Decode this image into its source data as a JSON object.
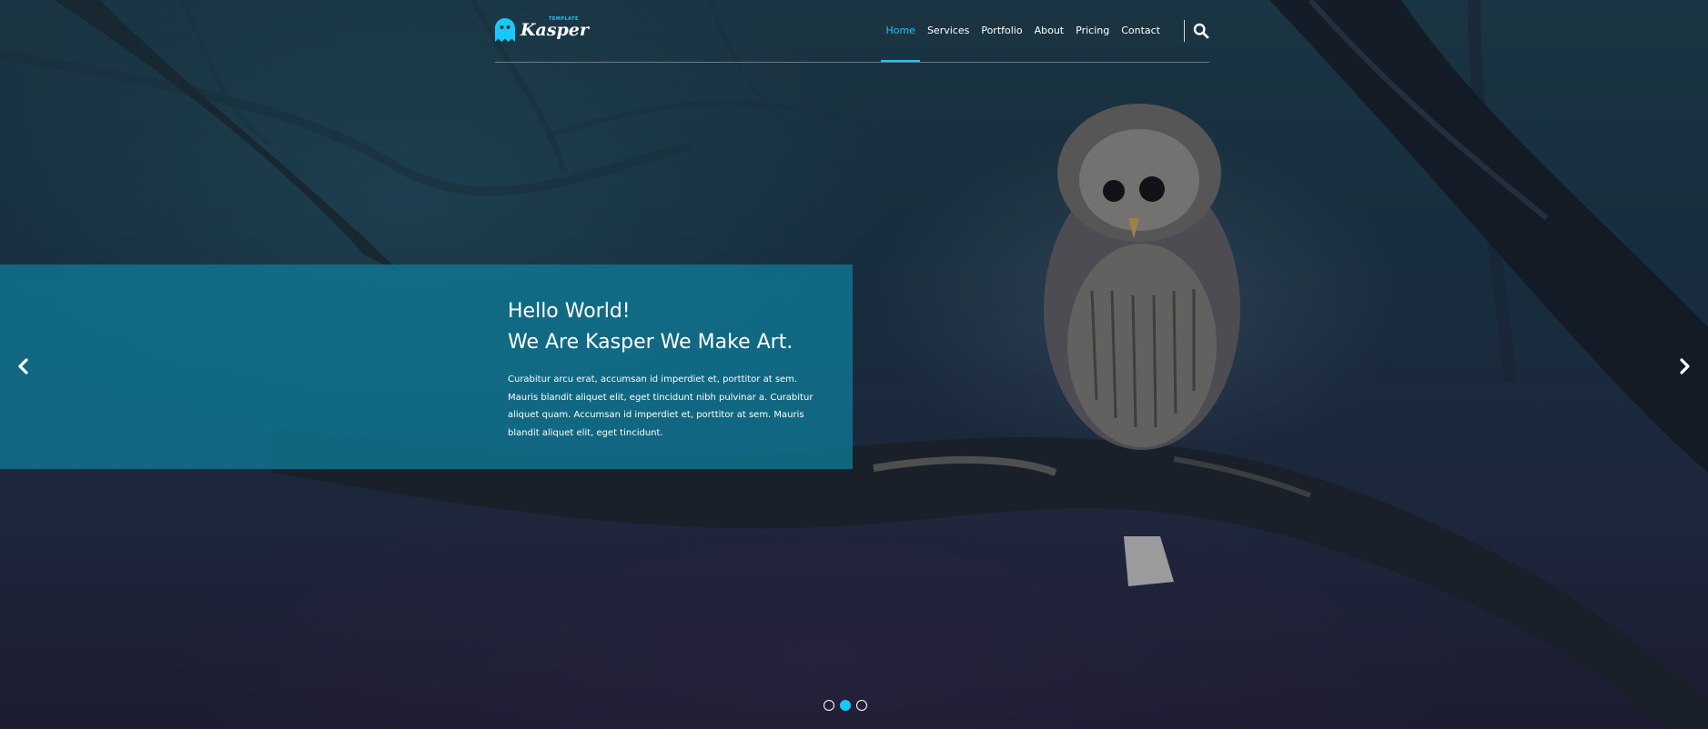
{
  "colors": {
    "accent": "#19c8fa",
    "caption_background": "#0e7f9d",
    "text": "#ffffff"
  },
  "header": {
    "logo": {
      "brand": "Kasper",
      "tagline": "TEMPLATE",
      "icon": "ghost-icon"
    },
    "nav": [
      {
        "label": "Home",
        "active": true
      },
      {
        "label": "Services",
        "active": false
      },
      {
        "label": "Portfolio",
        "active": false
      },
      {
        "label": "About",
        "active": false
      },
      {
        "label": "Pricing",
        "active": false
      },
      {
        "label": "Contact",
        "active": false
      }
    ],
    "search_icon": "search-icon"
  },
  "hero": {
    "background": "owl perched on a tree branch at dusk",
    "caption": {
      "line1": "Hello World!",
      "line2": "We Are Kasper We Make Art.",
      "text": "Curabitur arcu erat, accumsan id imperdiet et, porttitor at sem. Mauris blandit aliquet elit, eget tincidunt nibh pulvinar a. Curabitur aliquet quam. Accumsan id imperdiet et, porttitor at sem. Mauris blandit aliquet elit, eget tincidunt."
    },
    "controls": {
      "prev_icon": "chevron-left-icon",
      "next_icon": "chevron-right-icon",
      "slide_count": 3,
      "active_slide": 2
    }
  }
}
